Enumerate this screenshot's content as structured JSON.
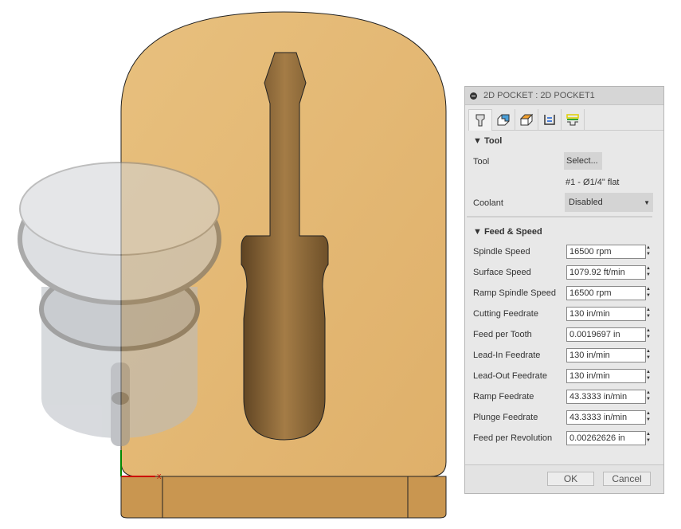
{
  "dialog": {
    "title": "2D POCKET : 2D POCKET1",
    "tabs": [
      {
        "name": "tool-tab"
      },
      {
        "name": "geometry-tab"
      },
      {
        "name": "heights-tab"
      },
      {
        "name": "passes-tab"
      },
      {
        "name": "linking-tab"
      }
    ],
    "tool_section": {
      "title": "Tool",
      "tool_label": "Tool",
      "select_label": "Select...",
      "tool_desc": "#1 - Ø1/4\" flat",
      "coolant_label": "Coolant",
      "coolant_value": "Disabled"
    },
    "feed_section": {
      "title": "Feed & Speed",
      "rows": [
        {
          "label": "Spindle Speed",
          "value": "16500 rpm"
        },
        {
          "label": "Surface Speed",
          "value": "1079.92 ft/min"
        },
        {
          "label": "Ramp Spindle Speed",
          "value": "16500 rpm"
        },
        {
          "label": "Cutting Feedrate",
          "value": "130 in/min"
        },
        {
          "label": "Feed per Tooth",
          "value": "0.0019697 in"
        },
        {
          "label": "Lead-In Feedrate",
          "value": "130 in/min"
        },
        {
          "label": "Lead-Out Feedrate",
          "value": "130 in/min"
        },
        {
          "label": "Ramp Feedrate",
          "value": "43.3333 in/min"
        },
        {
          "label": "Plunge Feedrate",
          "value": "43.3333 in/min"
        },
        {
          "label": "Feed per Revolution",
          "value": "0.00262626 in"
        }
      ]
    },
    "ok_label": "OK",
    "cancel_label": "Cancel"
  },
  "colors": {
    "wood": "#e2b46f",
    "wood_side": "#c9954f",
    "pocket": "#7a5a30"
  }
}
